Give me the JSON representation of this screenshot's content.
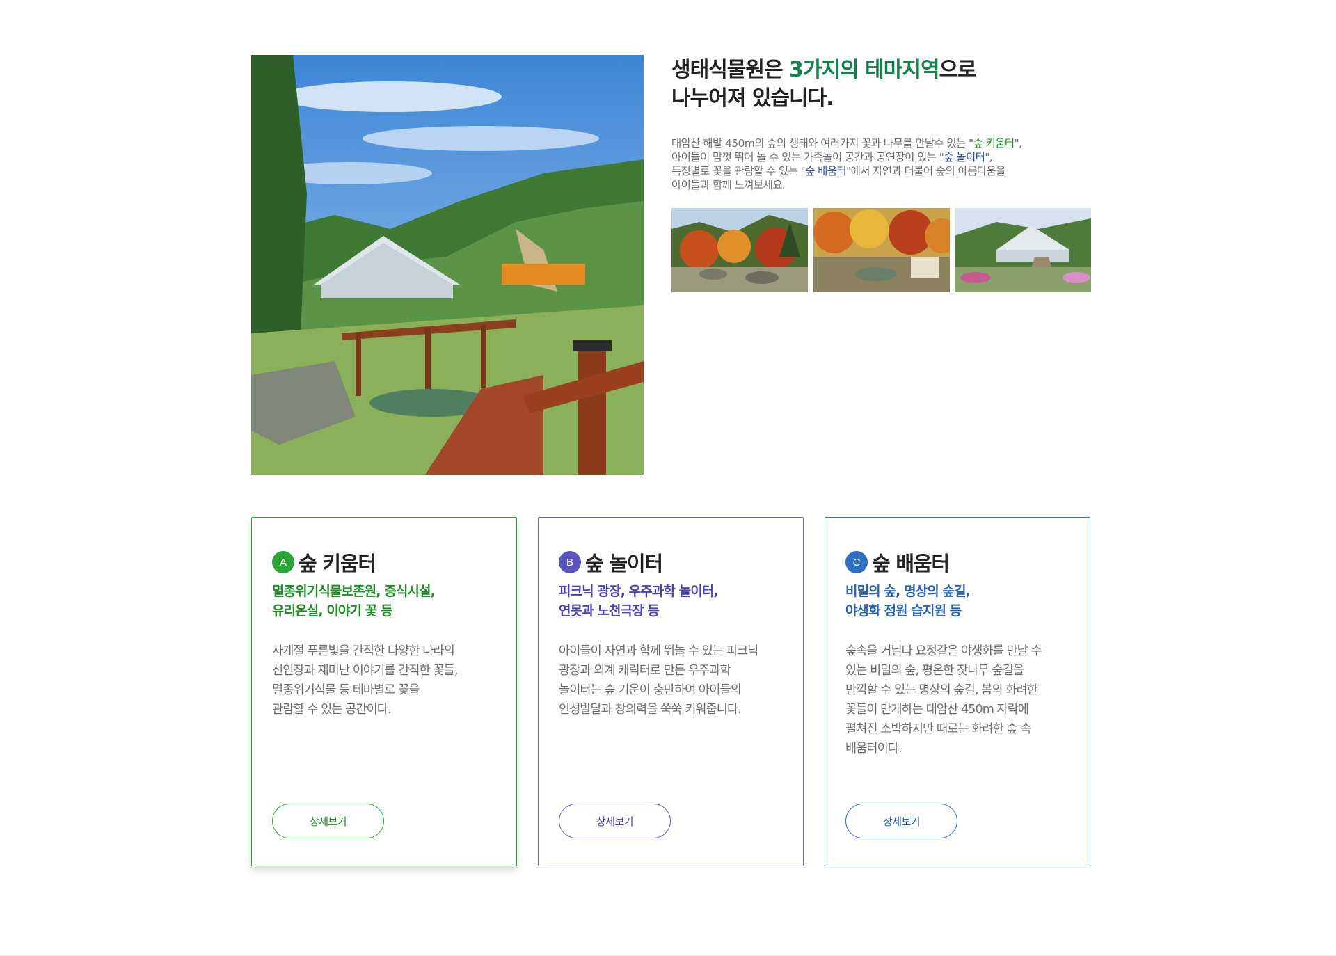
{
  "intro": {
    "headline_part1": "생태식물원은 ",
    "headline_highlight": "3가지의 테마지역",
    "headline_part2": "으로",
    "headline_line2": "나누어져 있습니다.",
    "desc_line1_a": "대암산 해발 450m의 숲의 생태와 여러가지 꽃과 나무를 만날수 있는 \"",
    "desc_line1_q": "숲 키움터",
    "desc_line1_b": "\",",
    "desc_line2_a": "아이들이 맘껏 뛰어 놀 수 있는 가족놀이 공간과 공연장이 있는 \"",
    "desc_line2_q": "숲 놀이터",
    "desc_line2_b": "\",",
    "desc_line3_a": "특징별로 꽃을 관람할 수 있는 \"",
    "desc_line3_q": "숲 배움터",
    "desc_line3_b": "\"에서 자연과 더불어 숲의 아름다움을",
    "desc_line4": "아이들과 함께 느껴보세요."
  },
  "cards": [
    {
      "badge": "A",
      "title": "숲 키움터",
      "sub_lines": [
        "멸종위기식물보존원, 증식시설,",
        "유리온실, 이야기 꽃 등"
      ],
      "body_lines": [
        "사계절 푸른빛을 간직한 다양한 나라의",
        "선인장과 재미난 이야기를 간직한 꽃들,",
        "멸종위기식물 등 테마별로 꽃을",
        "관람할 수 있는 공간이다."
      ],
      "button": "상세보기",
      "color": "#2ca43a"
    },
    {
      "badge": "B",
      "title": "숲 놀이터",
      "sub_lines": [
        "피크닉 광장, 우주과학 놀이터,",
        "연못과 노천극장 등"
      ],
      "body_lines": [
        "아이들이 자연과 함께 뛰놀 수 있는 피크닉",
        "광장과 외계 캐릭터로 만든 우주과학",
        "놀이터는 숲 기운이 충만하여 아이들의",
        "인성발달과 창의력을 쑥쑥 키워줍니다."
      ],
      "button": "상세보기",
      "color": "#5a55c0"
    },
    {
      "badge": "C",
      "title": "숲 배움터",
      "sub_lines": [
        "비밀의 숲, 명상의 숲길,",
        "야생화 정원 습지원 등"
      ],
      "body_lines": [
        "숲속을 거닐다 요정같은 야생화를 만날 수",
        "있는 비밀의 숲, 평온한 잣나무 숲길을",
        "만끽할 수 있는 명상의 숲길, 봄의 화려한",
        "꽃들이 만개하는 대암산 450m 자락에",
        "펼쳐진 소박하지만 때로는 화려한 숲 속",
        "배움터이다."
      ],
      "button": "상세보기",
      "color": "#2f6fbf"
    }
  ],
  "images": {
    "hero": "botanical-garden-photo",
    "thumbs": [
      "autumn-garden-photo",
      "autumn-pond-photo",
      "greenhouse-photo"
    ]
  }
}
